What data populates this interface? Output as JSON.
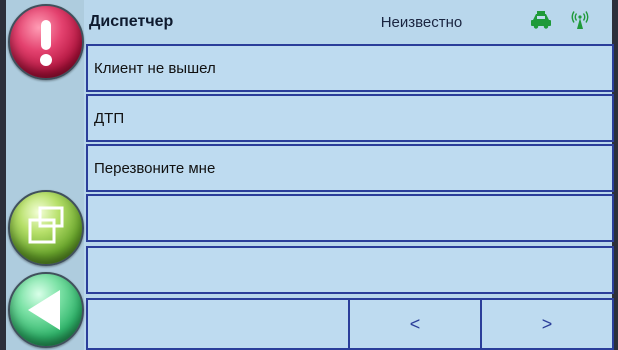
{
  "header": {
    "title": "Диспетчер",
    "status": "Неизвестно",
    "icons": [
      "taxi-car-icon",
      "signal-antenna-icon"
    ]
  },
  "sidebar": {
    "buttons": [
      {
        "name": "alert-button",
        "icon": "exclamation-icon"
      },
      {
        "name": "windows-button",
        "icon": "windows-icon"
      },
      {
        "name": "back-button",
        "icon": "back-arrow-icon"
      }
    ]
  },
  "list": {
    "items": [
      {
        "label": "Клиент не вышел"
      },
      {
        "label": "ДТП"
      },
      {
        "label": "Перезвоните мне"
      },
      {
        "label": ""
      },
      {
        "label": ""
      }
    ]
  },
  "pager": {
    "prev_label": "<",
    "next_label": ">"
  },
  "colors": {
    "accent": "#2b3e9a",
    "row_bg": "#bedbf0",
    "taxi_icon": "#1f9a3a"
  }
}
